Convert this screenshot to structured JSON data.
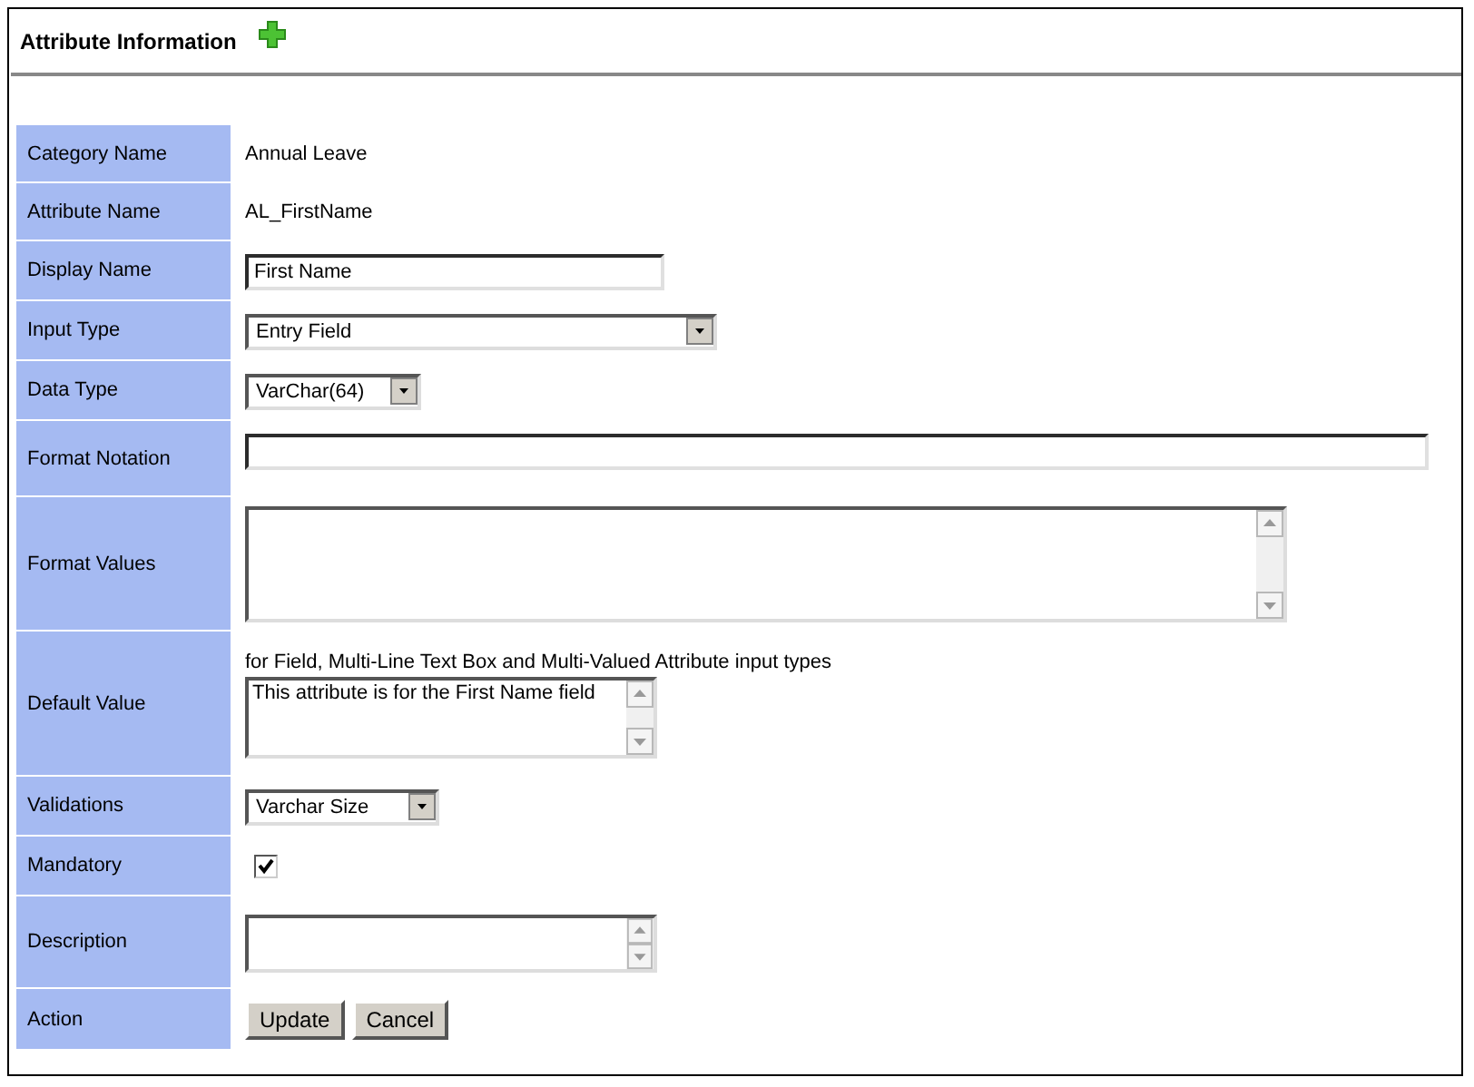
{
  "header": {
    "title": "Attribute Information"
  },
  "rows": [
    {
      "label": "Category Name",
      "kind": "text",
      "value": "Annual Leave"
    },
    {
      "label": "Attribute Name",
      "kind": "text",
      "value": "AL_FirstName"
    },
    {
      "label": "Display Name",
      "kind": "input",
      "value": "First Name"
    },
    {
      "label": "Input Type",
      "kind": "select",
      "value": "Entry Field"
    },
    {
      "label": "Data Type",
      "kind": "select",
      "value": "VarChar(64)"
    },
    {
      "label": "Format Notation",
      "kind": "input"
    },
    {
      "label": "Format Values",
      "kind": "textarea"
    },
    {
      "label": "Default Value",
      "kind": "textarea",
      "hint": "for Field, Multi-Line Text Box and Multi-Valued Attribute input types",
      "value": "This attribute is for the First Name field"
    },
    {
      "label": "Validations",
      "kind": "select",
      "value": "Varchar Size"
    },
    {
      "label": "Mandatory",
      "kind": "checkbox",
      "checked": true
    },
    {
      "label": "Description",
      "kind": "textarea"
    },
    {
      "label": "Action",
      "kind": "buttons",
      "buttons": [
        "Update",
        "Cancel"
      ]
    }
  ]
}
